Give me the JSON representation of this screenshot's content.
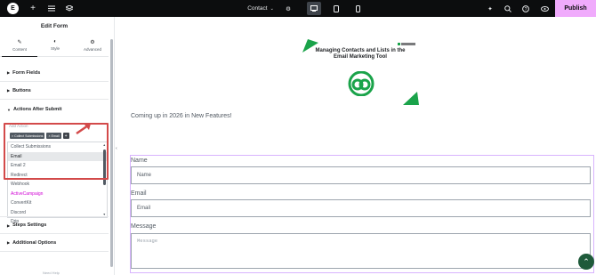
{
  "topbar": {
    "logo": "E",
    "page_name": "Contact",
    "publish": "Publish",
    "icons": [
      "plus-icon",
      "settings-sliders-icon",
      "layers-icon",
      "page-settings-icon",
      "desktop-icon",
      "tablet-icon",
      "mobile-icon",
      "apps-icon",
      "search-icon",
      "help-icon",
      "preview-icon"
    ]
  },
  "sidebar": {
    "title": "Edit Form",
    "tabs": [
      {
        "label": "Content",
        "icon": "pencil-icon"
      },
      {
        "label": "Style",
        "icon": "half-circle-icon"
      },
      {
        "label": "Advanced",
        "icon": "gear-icon"
      }
    ],
    "sections": {
      "form_fields": "Form Fields",
      "buttons": "Buttons",
      "actions_after_submit": "Actions After Submit",
      "steps_settings": "Steps Settings",
      "additional_options": "Additional Options"
    },
    "add_action_label": "Add Action",
    "chips": [
      "× Collect Submissions",
      "× Email"
    ],
    "chip_plus": "+",
    "dropdown_options": [
      "Collect Submissions",
      "Email",
      "Email 2",
      "Redirect",
      "Webhook",
      "ActiveCampaign",
      "ConvertKit",
      "Discord",
      "Drip"
    ],
    "footer": "Need Help"
  },
  "canvas": {
    "hero_text": "Managing Contacts and Lists in the Email Marketing Tool",
    "coming_up": "Coming up in 2026 in New Features!",
    "name_label": "Name",
    "name_placeholder": "Name",
    "email_label": "Email",
    "email_placeholder": "Email",
    "message_label": "Message",
    "message_placeholder": "Message"
  },
  "colors": {
    "brand_green": "#1aa34a",
    "publish_bg": "#f0abfc",
    "highlight_red": "#d34a4a"
  }
}
